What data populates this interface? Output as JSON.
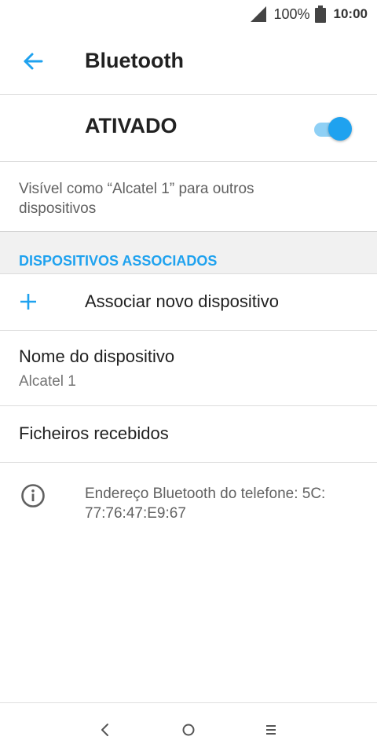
{
  "status_bar": {
    "signal_icon": "signal-icon",
    "battery_percent": "100%",
    "battery_icon": "battery-icon",
    "time": "10:00"
  },
  "app_bar": {
    "back_icon": "arrow-left-icon",
    "title": "Bluetooth"
  },
  "master_switch": {
    "label": "ATIVADO",
    "state": "on"
  },
  "visibility_text": "Visível como “Alcatel 1” para outros dispositivos",
  "paired_section": {
    "header": "DISPOSITIVOS ASSOCIADOS",
    "pair_new_label": "Associar novo dispositivo",
    "pair_new_icon": "plus-icon"
  },
  "device_name": {
    "title": "Nome do dispositivo",
    "value": "Alcatel 1"
  },
  "received_files": {
    "title": "Ficheiros recebidos"
  },
  "bt_address": {
    "icon": "info-icon",
    "text": "Endereço Bluetooth do telefone: 5C: 77:76:47:E9:67"
  },
  "nav_bar": {
    "back_icon": "nav-back-icon",
    "home_icon": "nav-home-icon",
    "recents_icon": "nav-recents-icon"
  },
  "colors": {
    "accent": "#1fa2ef",
    "accent_track": "#8fd0f5",
    "section_bg": "#f1f1f1",
    "divider": "#dcdcdc"
  }
}
